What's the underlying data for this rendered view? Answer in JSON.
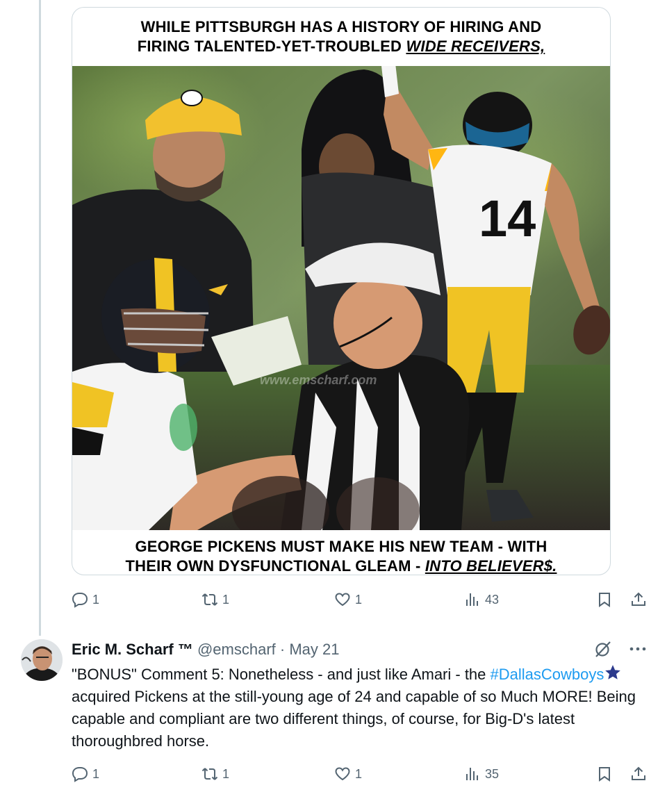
{
  "media": {
    "caption_top_line1": "WHILE PITTSBURGH HAS A HISTORY OF HIRING AND",
    "caption_top_line2_prefix": "FIRING TALENTED-YET-TROUBLED ",
    "caption_top_line2_emph": "WIDE RECEIVERS,",
    "caption_bottom_line1": "GEORGE PICKENS MUST MAKE HIS NEW TEAM - WITH",
    "caption_bottom_line2_prefix": "THEIR OWN DYSFUNCTIONAL GLEAM - ",
    "caption_bottom_line2_emph": "INTO BELIEVER$.",
    "jersey_number": "14",
    "watermark": "www.emscharf.com"
  },
  "tweet1_actions": {
    "replies": "1",
    "reposts": "1",
    "likes": "1",
    "views": "43"
  },
  "tweet2": {
    "display_name": "Eric M. Scharf ™",
    "handle": "@emscharf",
    "separator": "·",
    "date": "May 21",
    "text_part1": "\"BONUS\" Comment 5: Nonetheless - and just like Amari - the",
    "hashtag": "#DallasCowboys",
    "text_part2": " acquired Pickens at the still-young age of 24 and capable of so Much MORE! Being capable and compliant are two different things, of course, for Big-D's latest thoroughbred horse.",
    "actions": {
      "replies": "1",
      "reposts": "1",
      "likes": "1",
      "views": "35"
    }
  },
  "colors": {
    "link": "#1d9bf0",
    "muted": "#536471",
    "steelers_gold": "#ffb612"
  }
}
